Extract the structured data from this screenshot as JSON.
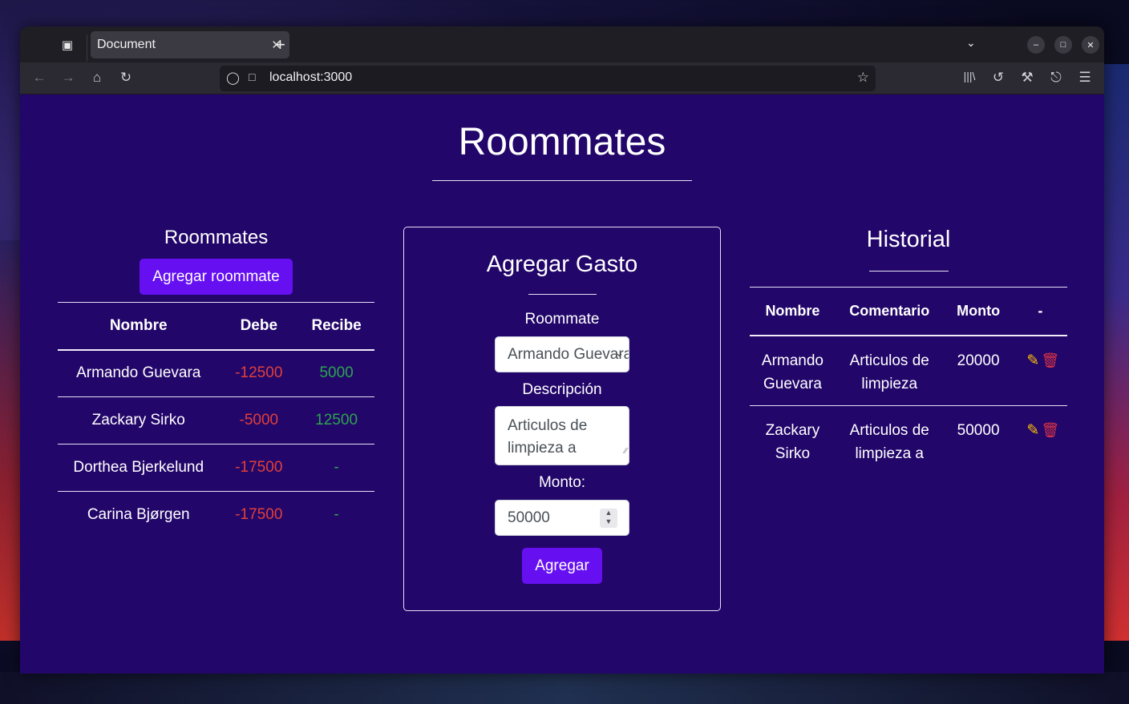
{
  "browser": {
    "tab_title": "Document",
    "url": "localhost:3000"
  },
  "page": {
    "title": "Roommates"
  },
  "roommates_panel": {
    "heading": "Roommates",
    "add_button": "Agregar roommate",
    "columns": [
      "Nombre",
      "Debe",
      "Recibe"
    ],
    "rows": [
      {
        "nombre": "Armando Guevara",
        "debe": "-12500",
        "recibe": "5000"
      },
      {
        "nombre": "Zackary Sirko",
        "debe": "-5000",
        "recibe": "12500"
      },
      {
        "nombre": "Dorthea Bjerkelund",
        "debe": "-17500",
        "recibe": "-"
      },
      {
        "nombre": "Carina Bjørgen",
        "debe": "-17500",
        "recibe": "-"
      }
    ]
  },
  "gasto_form": {
    "heading": "Agregar Gasto",
    "roommate_label": "Roommate",
    "roommate_value": "Armando Guevara",
    "descripcion_label": "Descripción",
    "descripcion_value": "Articulos de limpieza a",
    "monto_label": "Monto:",
    "monto_value": "50000",
    "submit_label": "Agregar"
  },
  "historial": {
    "heading": "Historial",
    "columns": [
      "Nombre",
      "Comentario",
      "Monto",
      "-"
    ],
    "rows": [
      {
        "nombre": "Armando Guevara",
        "comentario": "Articulos de limpieza",
        "monto": "20000"
      },
      {
        "nombre": "Zackary Sirko",
        "comentario": "Articulos de limpieza a",
        "monto": "50000"
      }
    ]
  },
  "colors": {
    "page_bg": "#22066a",
    "accent": "#6610f2",
    "negative": "#e0403a",
    "positive": "#2da44e",
    "edit_icon": "#ffc107",
    "delete_icon": "#dc3545"
  }
}
